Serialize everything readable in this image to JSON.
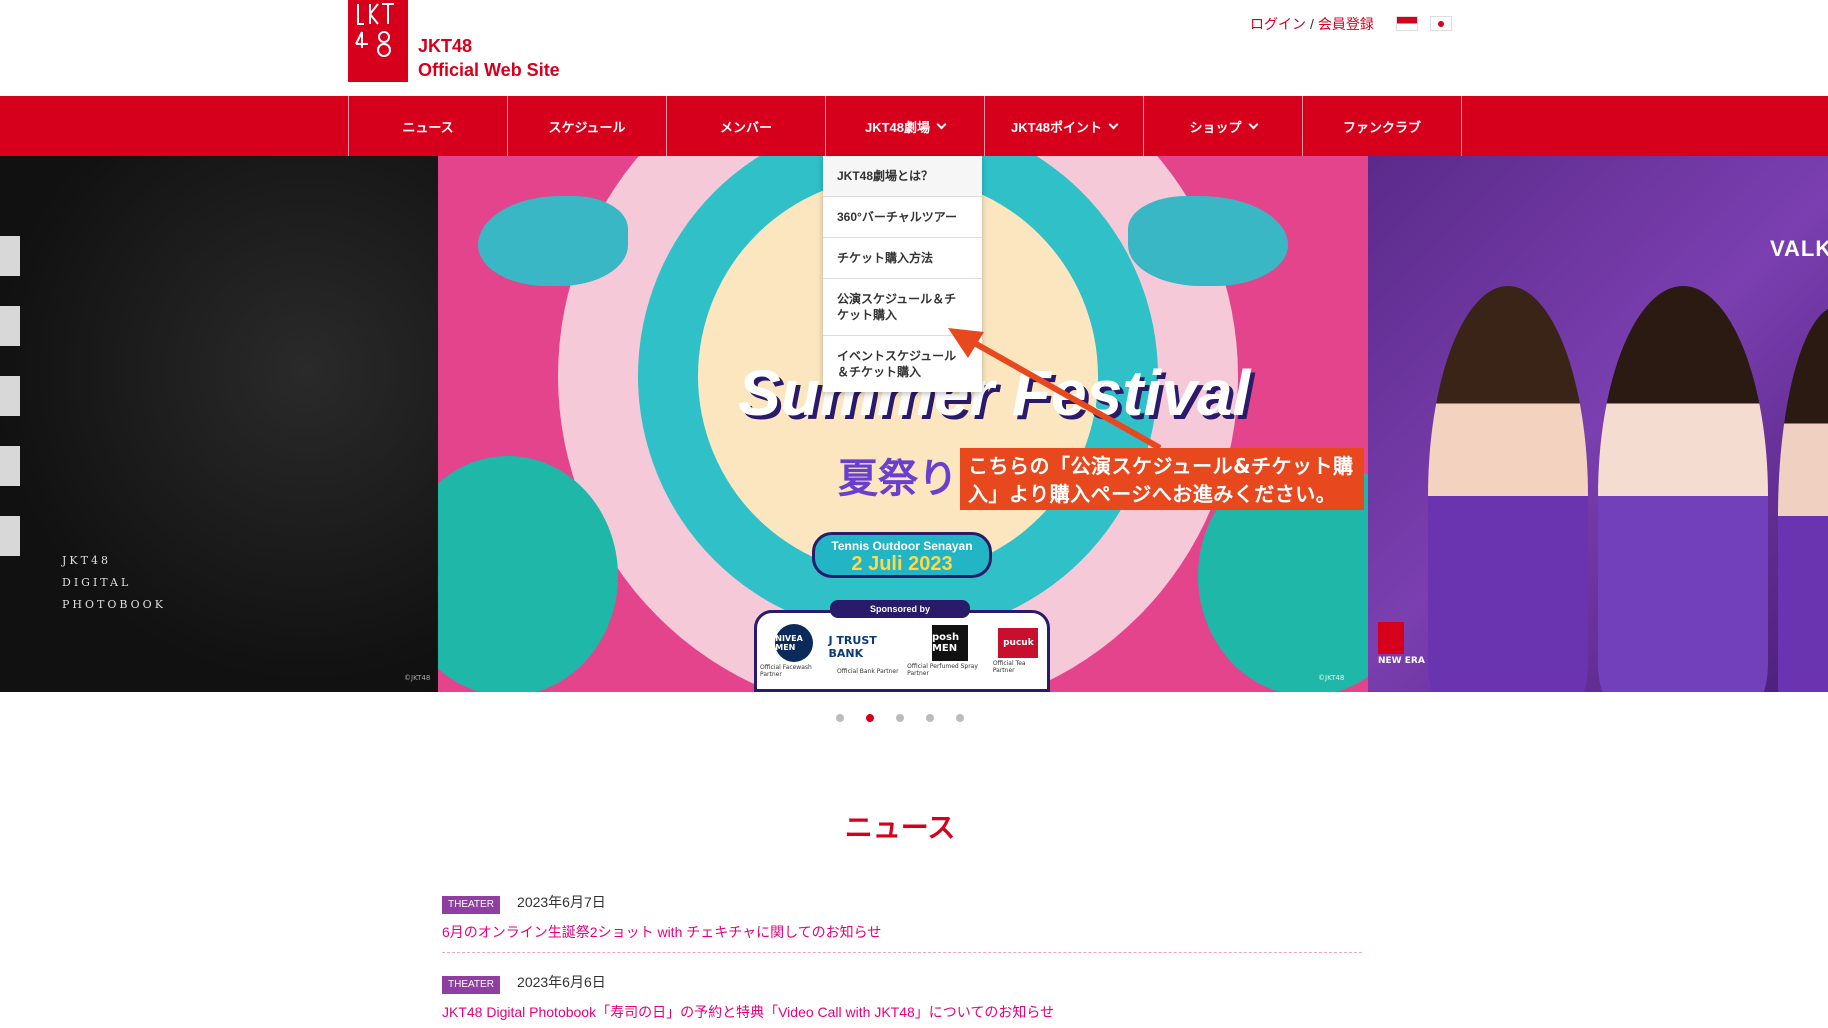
{
  "header": {
    "site_name_line1": "JKT48",
    "site_name_line2": "Official Web Site",
    "login": "ログイン",
    "separator": "/",
    "register": "会員登録",
    "brand_color": "#d6001c"
  },
  "nav": {
    "items": [
      {
        "label": "ニュース"
      },
      {
        "label": "スケジュール"
      },
      {
        "label": "メンバー"
      },
      {
        "label": "JKT48劇場"
      },
      {
        "label": "JKT48ポイント"
      },
      {
        "label": "ショップ"
      },
      {
        "label": "ファンクラブ"
      }
    ]
  },
  "dropdown": {
    "items": [
      {
        "label": "JKT48劇場とは？"
      },
      {
        "label": "360°バーチャルツアー"
      },
      {
        "label": "チケット購入方法"
      },
      {
        "label": "公演スケジュール＆チケット購入"
      },
      {
        "label": "イベントスケジュール＆チケット購入"
      }
    ]
  },
  "annotation": {
    "text": "こちらの「公演スケジュール&チケット購入」より購入ページへお進みください。",
    "color": "#e8481e"
  },
  "carousel": {
    "left": {
      "line1": "JKT48",
      "line2": "DIGITAL",
      "line3": "PHOTOBOOK",
      "copyright": "©JKT48"
    },
    "center": {
      "title": "Summer Festival",
      "subtitle": "夏祭り",
      "venue": "Tennis Outdoor Senayan",
      "date": "2 Juli 2023",
      "sponsored_by": "Sponsored by",
      "sponsors": [
        {
          "name": "NIVEA MEN",
          "role": "Official Facewash Partner"
        },
        {
          "name": "J TRUST BANK",
          "role": "Official Bank Partner"
        },
        {
          "name": "posh MEN",
          "role": "Official Perfumed Spray Partner"
        },
        {
          "name": "pucuk",
          "role": "Official Tea Partner"
        }
      ],
      "copyright": "©JKT48"
    },
    "right": {
      "team": "VALK",
      "era": "NEW ERA"
    },
    "active_dot": 1,
    "dot_count": 5
  },
  "news": {
    "title": "ニュース",
    "items": [
      {
        "badge": "THEATER",
        "date": "2023年6月7日",
        "text": "6月のオンライン生誕祭2ショット with チェキチャに関してのお知らせ"
      },
      {
        "badge": "THEATER",
        "date": "2023年6月6日",
        "text": "JKT48 Digital Photobook「寿司の日」の予約と特典「Video Call with JKT48」についてのお知らせ"
      }
    ]
  }
}
